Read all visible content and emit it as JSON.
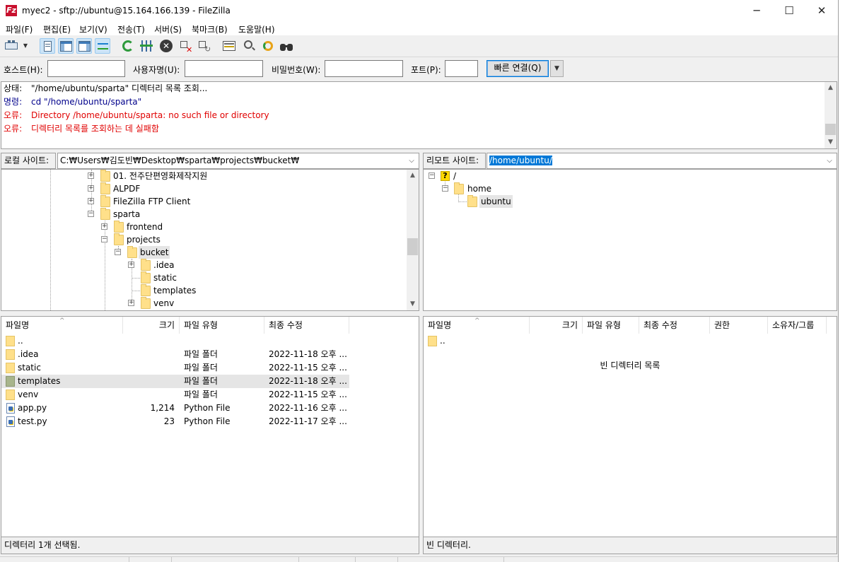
{
  "window": {
    "title": "myec2 - sftp://ubuntu@15.164.166.139 - FileZilla",
    "app_icon_glyph": "Fz",
    "controls": {
      "minimize": "─",
      "maximize": "☐",
      "close": "✕"
    }
  },
  "menu": [
    "파일(F)",
    "편집(E)",
    "보기(V)",
    "전송(T)",
    "서버(S)",
    "북마크(B)",
    "도움말(H)"
  ],
  "toolbar": {
    "icons": [
      "site-manager-icon",
      "dropdown-arrow-icon",
      "toggle-message-log-icon",
      "toggle-local-tree-icon",
      "toggle-remote-tree-icon",
      "toggle-transfer-queue-icon",
      "refresh-icon",
      "process-queue-icon",
      "cancel-icon",
      "disconnect-icon",
      "reconnect-icon",
      "directory-compare-icon",
      "filter-icon",
      "sync-browsing-icon",
      "search-icon"
    ]
  },
  "quickconnect": {
    "host_label": "호스트(H):",
    "user_label": "사용자명(U):",
    "pass_label": "비밀번호(W):",
    "port_label": "포트(P):",
    "host_value": "",
    "user_value": "",
    "pass_value": "",
    "port_value": "",
    "connect_button": "빠른 연결(Q)",
    "dropdown_glyph": "▼"
  },
  "log": [
    {
      "kind": "상태:",
      "text": "\"/home/ubuntu/sparta\" 디렉터리 목록 조회...",
      "type": "status"
    },
    {
      "kind": "명령:",
      "text": "cd \"/home/ubuntu/sparta\"",
      "type": "command"
    },
    {
      "kind": "오류:",
      "text": "Directory /home/ubuntu/sparta: no such file or directory",
      "type": "error"
    },
    {
      "kind": "오류:",
      "text": "디렉터리 목록를 조회하는 데 실패함",
      "type": "error"
    }
  ],
  "local": {
    "site_label": "로컬 사이트:",
    "path": "C:₩Users₩김도빈₩Desktop₩sparta₩projects₩bucket₩",
    "tree": [
      {
        "label": "01. 전주단편영화제작지원",
        "expander": "+"
      },
      {
        "label": "ALPDF",
        "expander": "+"
      },
      {
        "label": "FileZilla FTP Client",
        "expander": "+"
      },
      {
        "label": "sparta",
        "expander": "−"
      },
      {
        "label": "frontend",
        "expander": "+"
      },
      {
        "label": "projects",
        "expander": "−"
      },
      {
        "label": "bucket",
        "expander": "−"
      },
      {
        "label": ".idea",
        "expander": "+"
      },
      {
        "label": "static",
        "expander": ""
      },
      {
        "label": "templates",
        "expander": ""
      },
      {
        "label": "venv",
        "expander": "+"
      }
    ],
    "columns": [
      "파일명",
      "크기",
      "파일 유형",
      "최종 수정"
    ],
    "files": [
      {
        "name": "..",
        "size": "",
        "type": "",
        "modified": "",
        "icon": "folder-icon"
      },
      {
        "name": ".idea",
        "size": "",
        "type": "파일 폴더",
        "modified": "2022-11-18 오후 ...",
        "icon": "folder-icon"
      },
      {
        "name": "static",
        "size": "",
        "type": "파일 폴더",
        "modified": "2022-11-15 오후 ...",
        "icon": "folder-icon"
      },
      {
        "name": "templates",
        "size": "",
        "type": "파일 폴더",
        "modified": "2022-11-18 오후 ...",
        "icon": "folder-icon"
      },
      {
        "name": "venv",
        "size": "",
        "type": "파일 폴더",
        "modified": "2022-11-15 오후 ...",
        "icon": "folder-icon"
      },
      {
        "name": "app.py",
        "size": "1,214",
        "type": "Python File",
        "modified": "2022-11-16 오후 ...",
        "icon": "python-file-icon"
      },
      {
        "name": "test.py",
        "size": "23",
        "type": "Python File",
        "modified": "2022-11-17 오후 ...",
        "icon": "python-file-icon"
      }
    ],
    "status": "디렉터리 1개 선택됨."
  },
  "remote": {
    "site_label": "리모트 사이트:",
    "path": "/home/ubuntu/",
    "tree": [
      {
        "label": "/",
        "expander": "−"
      },
      {
        "label": "home",
        "expander": "−"
      },
      {
        "label": "ubuntu",
        "expander": ""
      }
    ],
    "unknown_glyph": "?",
    "columns": [
      "파일명",
      "크기",
      "파일 유형",
      "최종 수정",
      "권한",
      "소유자/그룹"
    ],
    "files": [
      {
        "name": "..",
        "icon": "folder-icon"
      }
    ],
    "empty_message": "빈 디렉터리 목록",
    "status": "빈 디렉터리."
  },
  "common": {
    "combo_arrow": "⌵",
    "scroll_up": "▲",
    "scroll_down": "▼",
    "sort_arrow": "^"
  }
}
